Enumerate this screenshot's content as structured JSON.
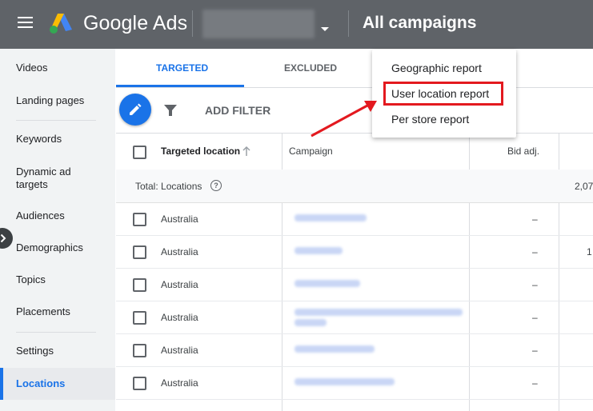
{
  "header": {
    "brand": "Google Ads",
    "page_title": "All campaigns"
  },
  "sidebar": {
    "items": [
      {
        "label": "Videos"
      },
      {
        "label": "Landing pages"
      },
      {
        "label": "Keywords"
      },
      {
        "label": "Dynamic ad targets"
      },
      {
        "label": "Audiences"
      },
      {
        "label": "Demographics"
      },
      {
        "label": "Topics"
      },
      {
        "label": "Placements"
      },
      {
        "label": "Settings"
      },
      {
        "label": "Locations"
      }
    ],
    "active": "Locations"
  },
  "tabs": [
    {
      "label": "TARGETED",
      "active": true
    },
    {
      "label": "EXCLUDED",
      "active": false
    }
  ],
  "toolbar": {
    "add_filter": "ADD FILTER"
  },
  "table": {
    "headers": [
      "Targeted location",
      "Campaign",
      "Bid adj."
    ],
    "total_label": "Total: Locations",
    "total_value": "2,07",
    "rows": [
      {
        "location": "Australia",
        "bid_adj": "–",
        "value": ""
      },
      {
        "location": "Australia",
        "bid_adj": "–",
        "value": "1"
      },
      {
        "location": "Australia",
        "bid_adj": "–",
        "value": ""
      },
      {
        "location": "Australia",
        "bid_adj": "–",
        "value": ""
      },
      {
        "location": "Australia",
        "bid_adj": "–",
        "value": ""
      },
      {
        "location": "Australia",
        "bid_adj": "–",
        "value": ""
      }
    ]
  },
  "menu": {
    "items": [
      "Geographic report",
      "User location report",
      "Per store report"
    ],
    "highlighted": "User location report"
  },
  "colors": {
    "topbar": "#5f6368",
    "accent": "#1a73e8",
    "highlight": "#e3191f"
  }
}
